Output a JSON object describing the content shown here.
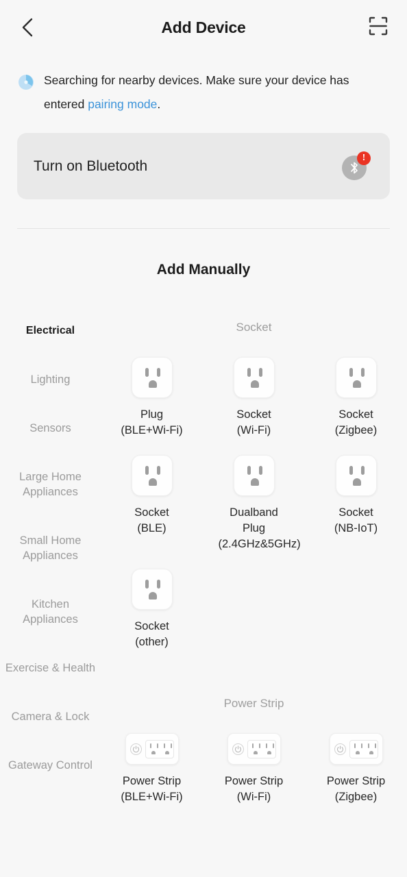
{
  "header": {
    "title": "Add Device",
    "back_icon": "chevron-left-icon",
    "scan_icon": "scan-qr-icon"
  },
  "searching": {
    "icon": "radar-loading-icon",
    "text_before": "Searching for nearby devices. Make sure your device has entered ",
    "link": "pairing mode",
    "text_after": "."
  },
  "bluetooth_card": {
    "label": "Turn on Bluetooth",
    "icon": "bluetooth-icon",
    "badge": "!",
    "badge_color": "#ea3323",
    "icon_bg_color": "#b3b3b3",
    "card_bg_color": "#e9e9e9"
  },
  "add_manually": {
    "title": "Add Manually"
  },
  "sidebar": {
    "items": [
      {
        "label": "Electrical",
        "active": true
      },
      {
        "label": "Lighting",
        "active": false
      },
      {
        "label": "Sensors",
        "active": false
      },
      {
        "label": "Large Home Appliances",
        "active": false
      },
      {
        "label": "Small Home Appliances",
        "active": false
      },
      {
        "label": "Kitchen Appliances",
        "active": false
      },
      {
        "label": "Exercise & Health",
        "active": false
      },
      {
        "label": "Camera & Lock",
        "active": false
      },
      {
        "label": "Gateway Control",
        "active": false
      }
    ]
  },
  "sections": [
    {
      "title": "Socket",
      "icon_type": "socket",
      "items": [
        {
          "label": "Plug\n(BLE+Wi-Fi)"
        },
        {
          "label": "Socket\n(Wi-Fi)"
        },
        {
          "label": "Socket\n(Zigbee)"
        },
        {
          "label": "Socket\n(BLE)"
        },
        {
          "label": "Dualband Plug\n(2.4GHz&5GHz)"
        },
        {
          "label": "Socket\n(NB-IoT)"
        },
        {
          "label": "Socket\n(other)"
        }
      ]
    },
    {
      "title": "Power Strip",
      "icon_type": "power-strip",
      "items": [
        {
          "label": "Power Strip\n(BLE+Wi-Fi)"
        },
        {
          "label": "Power Strip\n(Wi-Fi)"
        },
        {
          "label": "Power Strip\n(Zigbee)"
        }
      ]
    }
  ],
  "colors": {
    "background": "#f7f7f7",
    "link": "#3a92d9",
    "text_primary": "#1b1b1b",
    "text_muted": "#9b9b9b"
  }
}
